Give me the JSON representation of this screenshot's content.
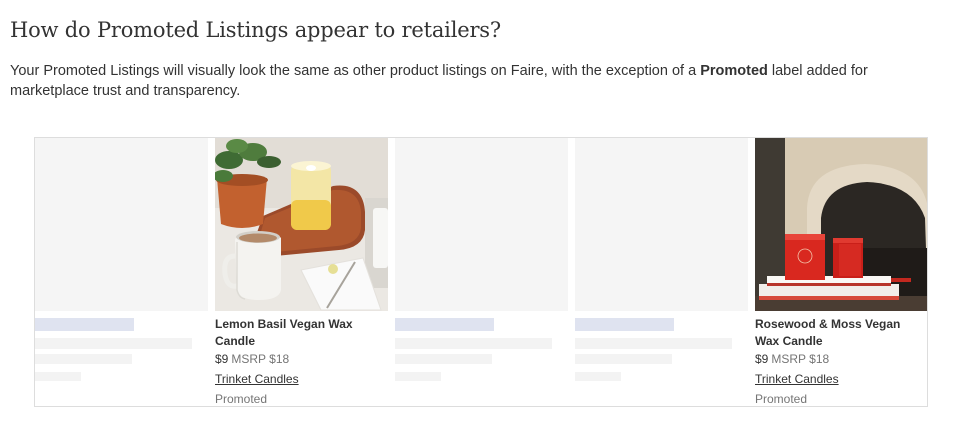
{
  "heading": "How do Promoted Listings appear to retailers?",
  "description": {
    "before": "Your Promoted Listings will visually look the same as other product listings on Faire, with the exception of a ",
    "bold": "Promoted",
    "after": " label added for marketplace trust and transparency."
  },
  "products": [
    {
      "name": "Lemon Basil Vegan Wax Candle",
      "price": "$9",
      "msrp": "MSRP $18",
      "brand": "Trinket Candles",
      "label": "Promoted",
      "image": "candle-with-mug-photo"
    },
    {
      "name": "Rosewood & Moss Vegan Wax Candle",
      "price": "$9",
      "msrp": "MSRP $18",
      "brand": "Trinket Candles",
      "label": "Promoted",
      "image": "red-candle-box-fireplace-photo"
    }
  ],
  "colors": {
    "text": "#333333",
    "muted": "#757575",
    "placeholder_accent": "#dfe3f0",
    "placeholder_light": "#f3f3f3",
    "image_placeholder": "#f5f5f5",
    "border": "#dddddd"
  }
}
